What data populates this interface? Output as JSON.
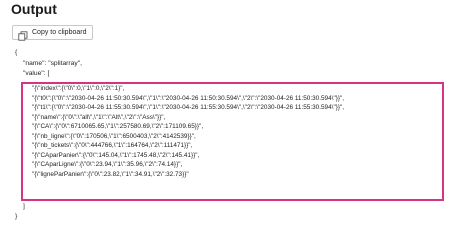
{
  "header": {
    "title": "Output",
    "copy_button_label": "Copy to clipboard"
  },
  "code": {
    "open_brace": "{",
    "name_line": "\"name\": \"splitarray\",",
    "value_key_line": "\"value\": [",
    "value_lines": [
      "\"{\\\"index\\\":{\\\"0\\\":0,\\\"1\\\":0,\\\"2\\\":1}\",",
      "\"{\\\"t0\\\":{\\\"0\\\":\\\"2030-04-26 11:50:30.594\\\",\\\"1\\\":\\\"2030-04-26 11:50:30.594\\\",\\\"2\\\":\\\"2030-04-26 11:50:30.594\\\"}}\",",
      "\"{\\\"t1\\\":{\\\"0\\\":\\\"2030-04-26 11:55:30.594\\\",\\\"1\\\":\\\"2030-04-26 11:55:30.594\\\",\\\"2\\\":\\\"2030-04-26 11:55:30.594\\\"}}\",",
      "\"{\\\"name\\\":{\\\"0\\\":\\\"all\\\",\\\"1\\\":\\\"Alt\\\",\\\"2\\\":\\\"Ass\\\"}}\",",
      "\"{\\\"CA\\\":{\\\"0\\\":6710065.65,\\\"1\\\":257580.69,\\\"2\\\":171109.65}}\",",
      "\"{\\\"nb_ligne\\\":{\\\"0\\\":170506,\\\"1\\\":6500403,\\\"2\\\":4142539}}\",",
      "\"{\\\"nb_tickets\\\":{\\\"0\\\":444766,\\\"1\\\":164764,\\\"2\\\":111471}}\",",
      "\"{\\\"CAparPanier\\\":{\\\"0\\\":145.04,\\\"1\\\":1745.48,\\\"2\\\":145.41}}\",",
      "\"{\\\"CAparLigne\\\":{\\\"0\\\":23.94,\\\"1\\\":35.96,\\\"2\\\":74.14}}\",",
      "\"{\\\"ligneParPanier\\\":{\\\"0\\\":23.82,\\\"1\\\":34.91,\\\"2\\\":32.73}}\""
    ],
    "close_bracket": "]",
    "close_brace": "}"
  },
  "colors": {
    "highlight_border": "#d63384"
  },
  "icons": {
    "copy": "copy-icon"
  }
}
